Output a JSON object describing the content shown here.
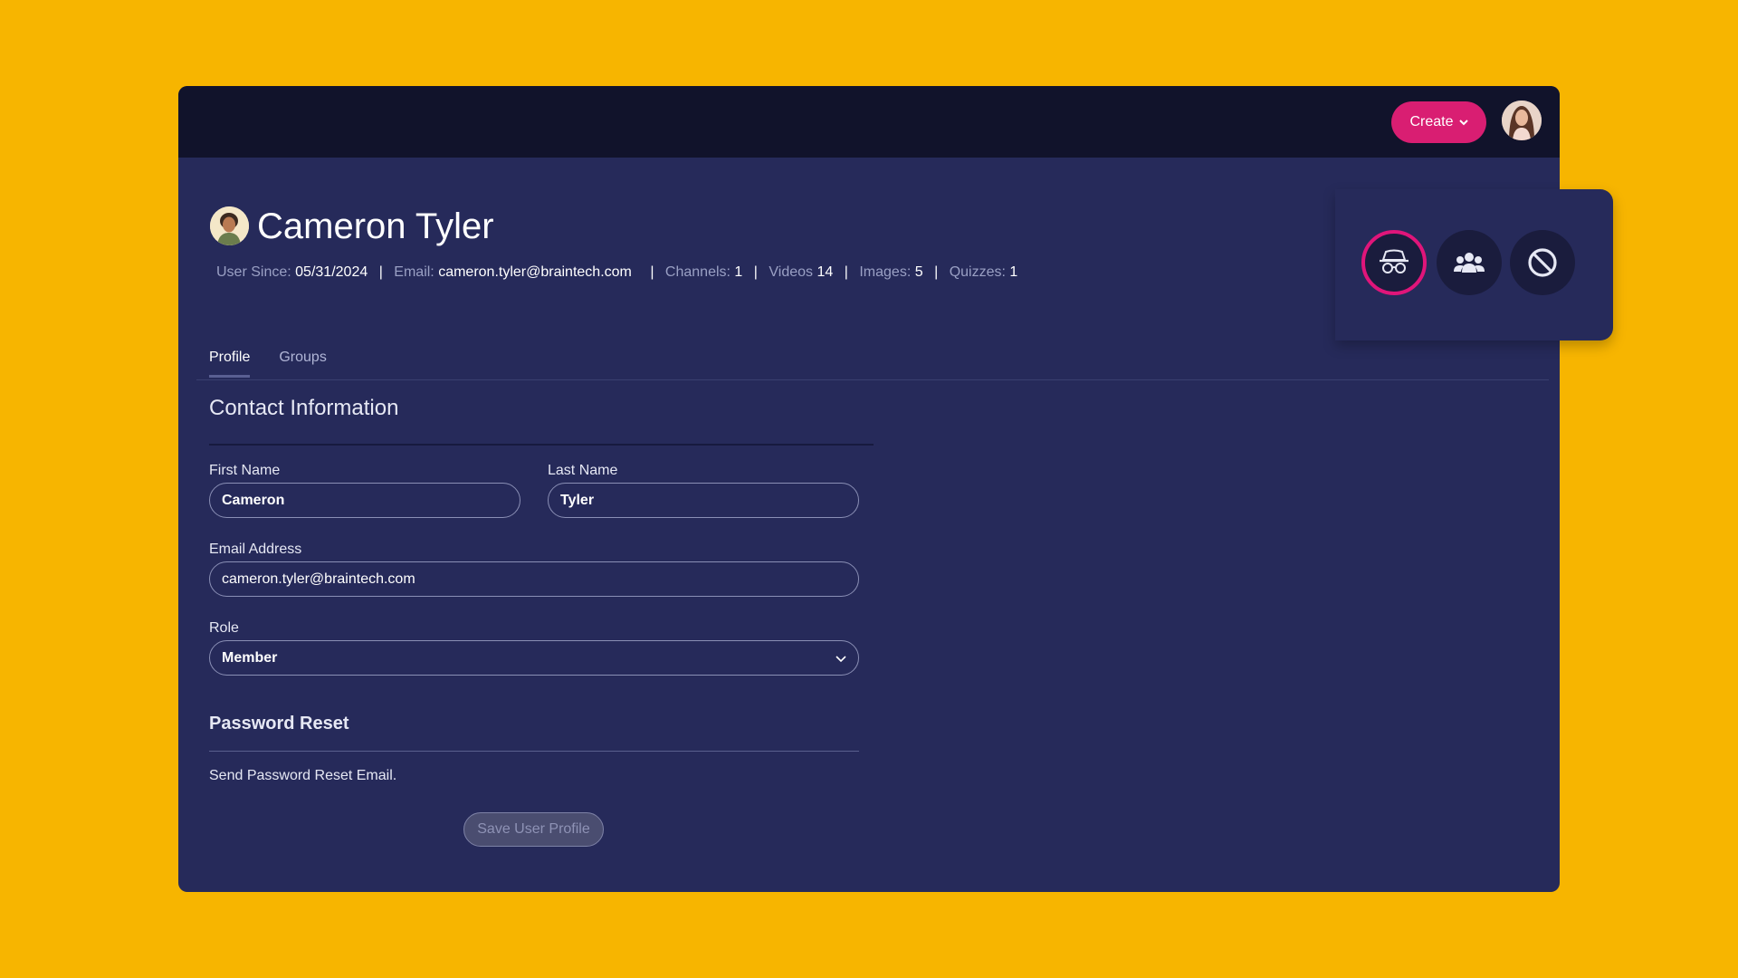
{
  "topbar": {
    "create_label": "Create"
  },
  "user": {
    "name": "Cameron Tyler",
    "meta": {
      "user_since_label": "User Since:",
      "user_since": "05/31/2024",
      "email_label": "Email:",
      "email": "cameron.tyler@braintech.com",
      "channels_label": "Channels:",
      "channels": "1",
      "videos_label": "Videos",
      "videos": "14",
      "images_label": "Images:",
      "images": "5",
      "quizzes_label": "Quizzes:",
      "quizzes": "1"
    }
  },
  "actions": [
    {
      "icon": "incognito-icon"
    },
    {
      "icon": "users-icon"
    },
    {
      "icon": "block-icon"
    }
  ],
  "tabs": [
    {
      "label": "Profile",
      "active": true
    },
    {
      "label": "Groups",
      "active": false
    }
  ],
  "contact": {
    "title": "Contact Information",
    "first_name_label": "First Name",
    "first_name": "Cameron",
    "last_name_label": "Last Name",
    "last_name": "Tyler",
    "email_label": "Email Address",
    "email": "cameron.tyler@braintech.com",
    "role_label": "Role",
    "role": "Member"
  },
  "password": {
    "title": "Password Reset",
    "text": "Send Password Reset Email."
  },
  "save_label": "Save User Profile",
  "colors": {
    "background": "#F7B500",
    "panel": "#262A5A",
    "topbar": "#11132B",
    "accent": "#D91E72"
  }
}
